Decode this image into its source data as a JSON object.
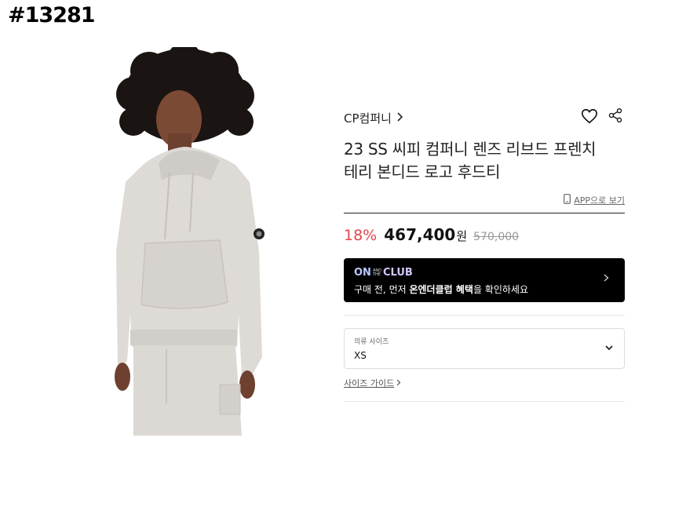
{
  "post_id": "#13281",
  "product": {
    "brand": "CP컴퍼니",
    "title_line1": "23 SS 씨피 컴퍼니 렌즈 리브드 프렌치",
    "title_line2": "테리 본디드 로고 후드티",
    "app_view": "APP으로 보기",
    "image_alt": "light grey hoodie worn by model"
  },
  "pricing": {
    "discount": "18%",
    "price": "467,400",
    "currency": "원",
    "original": "570,000",
    "discount_color": "#e0474c"
  },
  "club_banner": {
    "logo_on": "ON",
    "logo_and_1": "AND",
    "logo_and_2": "THE",
    "logo_club": "CLUB",
    "text_prefix": "구매 전, 먼저 ",
    "text_bold": "온엔더클럽 혜택",
    "text_suffix": "을 확인하세요"
  },
  "size_select": {
    "label": "의류 사이즈",
    "value": "XS"
  },
  "size_guide": "사이즈 가이드",
  "icons": [
    "chevron-right-icon",
    "heart-icon",
    "share-icon",
    "phone-icon",
    "chevron-down-icon"
  ]
}
